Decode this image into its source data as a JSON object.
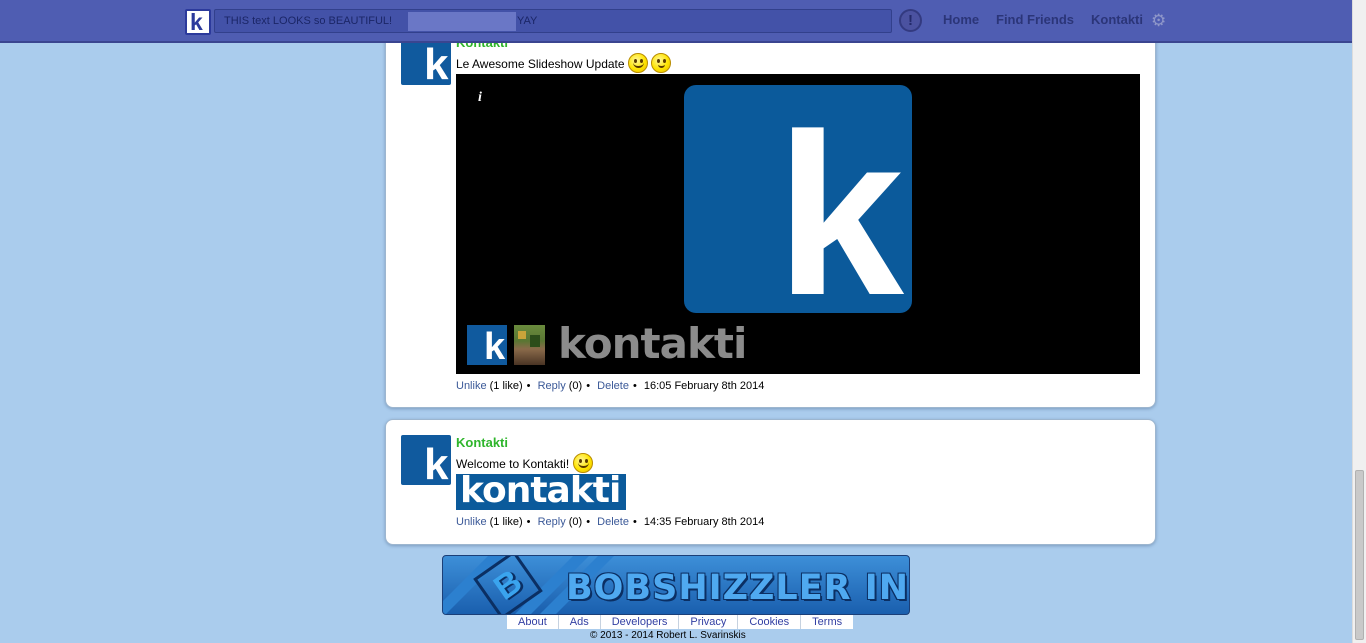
{
  "header": {
    "search_text_before": "THIS text LOOKS so BEAUTIFUL!",
    "search_text_after": "YAY",
    "alert_glyph": "!",
    "nav": [
      "Home",
      "Find Friends",
      "Kontakti"
    ],
    "accent": "#4f5db2"
  },
  "posts": [
    {
      "author": "Kontakti",
      "text": "Le Awesome Slideshow Update",
      "slideshow": {
        "info": "i",
        "wordmark": "kontakti",
        "big_letter": "k"
      },
      "actions": {
        "unlike": "Unlike",
        "like_count": "(1 like)",
        "reply": "Reply",
        "reply_count": "(0)",
        "delete": "Delete",
        "time": "16:05 February 8th 2014"
      }
    },
    {
      "author": "Kontakti",
      "text": "Welcome to Kontakti!",
      "wordmark": "kontakti",
      "actions": {
        "unlike": "Unlike",
        "like_count": "(1 like)",
        "reply": "Reply",
        "reply_count": "(0)",
        "delete": "Delete",
        "time": "14:35 February 8th 2014"
      }
    }
  ],
  "avatar_letter": "k",
  "footer": {
    "banner_text": "BOBSHIZZLER INC",
    "banner_mark": "B",
    "links": [
      "About",
      "Ads",
      "Developers",
      "Privacy",
      "Cookies",
      "Terms"
    ],
    "copyright": "© 2013 - 2014 Robert L. Svarinskis"
  },
  "colors": {
    "author": "#2fb52c",
    "link": "#3b5998",
    "brand": "#105a9e",
    "page_bg": "#aacced"
  }
}
